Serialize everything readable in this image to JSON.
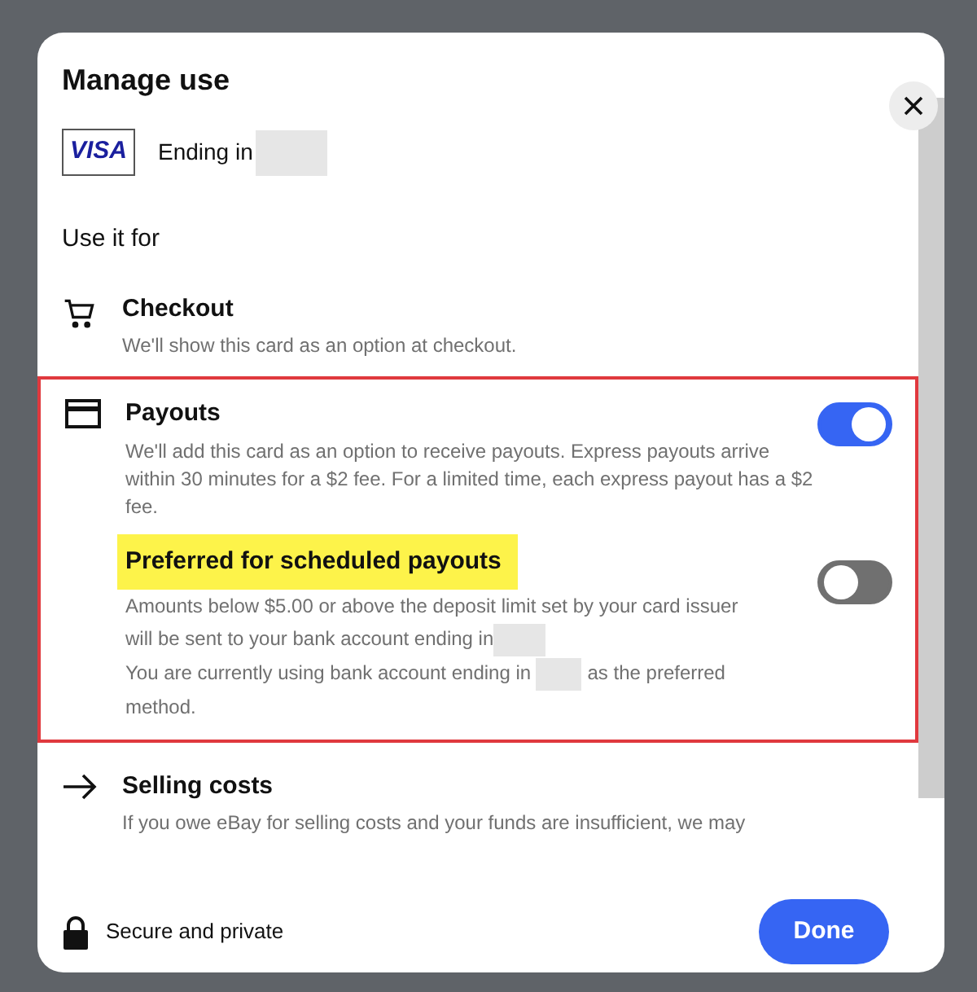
{
  "dialog": {
    "title": "Manage use",
    "card": {
      "brand": "VISA",
      "ending_label": "Ending in"
    },
    "section_label": "Use it for",
    "options": [
      {
        "kind": "plain",
        "title": "Checkout",
        "description": "We'll show this card as an option at checkout."
      },
      {
        "kind": "toggle",
        "title": "Payouts",
        "description": "We'll add this card as an option to receive payouts. Express payouts arrive within 30 minutes for a $2 fee. For a limited time, each express payout has a $2 fee.",
        "on": true,
        "highlighted": true,
        "sub": {
          "title": "Preferred for scheduled payouts",
          "title_highlighted": true,
          "on": false,
          "line1": "Amounts below $5.00 or above the deposit limit set by your card issuer will be sent to your bank account ending in",
          "line2a": "You are currently using bank account ending in",
          "line2b": "as the preferred method."
        }
      },
      {
        "kind": "plain",
        "title": "Selling costs",
        "description": "If you owe eBay for selling costs and your funds are insufficient, we may"
      }
    ],
    "footer": {
      "secure_label": "Secure and private",
      "done_button": "Done"
    }
  }
}
